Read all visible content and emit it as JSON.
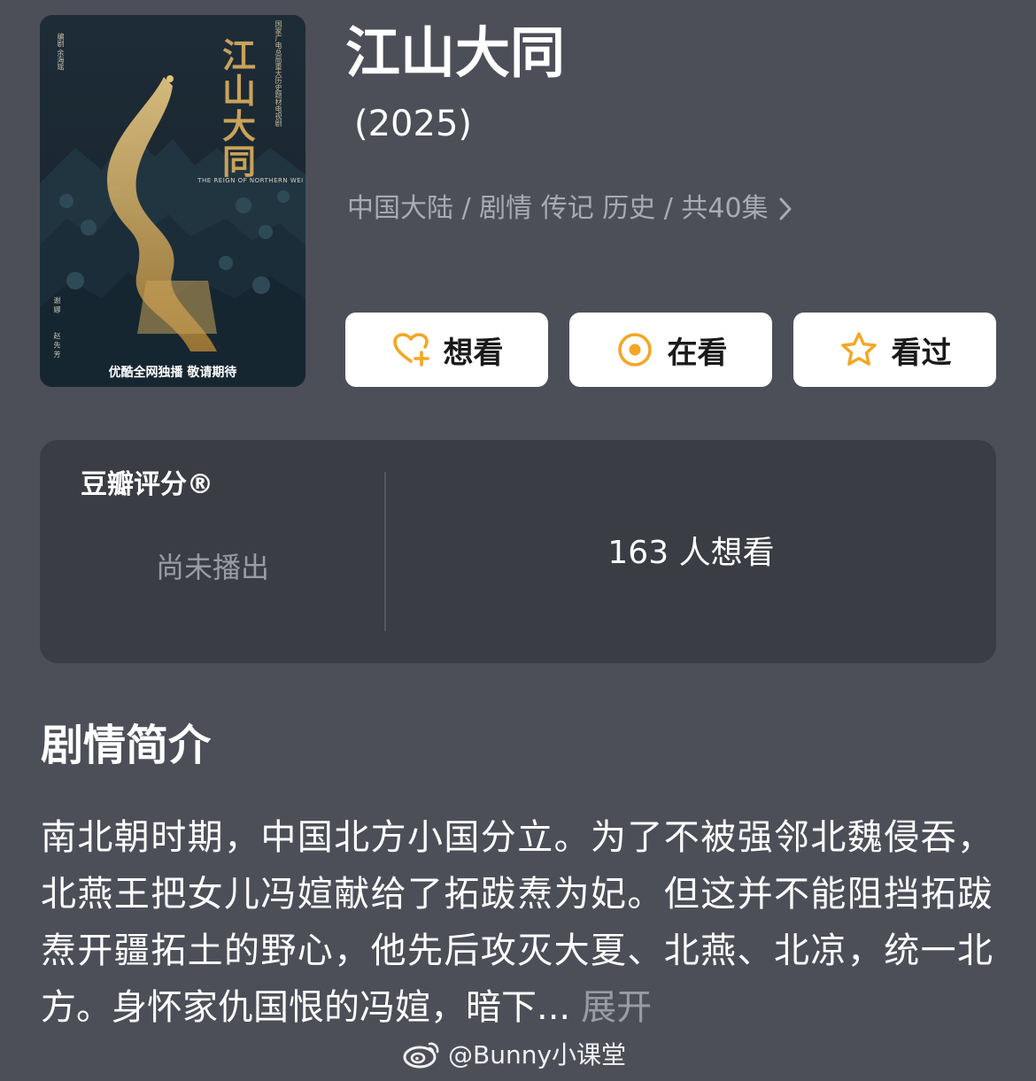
{
  "poster": {
    "title": "江山大同",
    "vertical_text": "国家广电总局重大历史题材电视剧",
    "english_title": "THE REIGN OF NORTHERN WEI",
    "credit_left": "编剧 余海瑶",
    "credit_bottom_1": "谢 娜",
    "credit_bottom_2": "赵 先 芳",
    "tagline": "优酷全网独播 敬请期待"
  },
  "title": "江山大同",
  "year": "(2025)",
  "meta": "中国大陆 / 剧情 传记 历史 / 共40集",
  "actions": {
    "want": "想看",
    "watching": "在看",
    "watched": "看过"
  },
  "rating": {
    "label": "豆瓣评分®",
    "status": "尚未播出",
    "wants": "163 人想看"
  },
  "synopsis": {
    "heading": "剧情简介",
    "text": "南北朝时期，中国北方小国分立。为了不被强邻北魏侵吞，北燕王把女儿冯媗献给了拓跋焘为妃。但这并不能阻挡拓跋焘开疆拓土的野心，他先后攻灭大夏、北燕、北凉，统一北方。身怀家仇国恨的冯媗，暗下...",
    "expand": "展开"
  },
  "watermark": "@Bunny小课堂",
  "colors": {
    "background": "#4d4f58",
    "card": "#3b3d45",
    "accent": "#f5a623",
    "muted": "#9a9ca3"
  },
  "icons": {
    "want": "heart-plus-icon",
    "watching": "target-icon",
    "watched": "star-icon",
    "meta": "chevron-right-icon",
    "watermark": "weibo-icon"
  }
}
